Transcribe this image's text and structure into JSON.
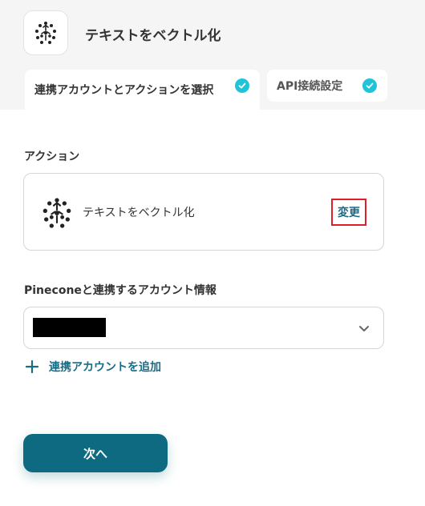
{
  "header": {
    "title": "テキストをベクトル化",
    "app_icon": "pinecone-logo-icon"
  },
  "tabs": [
    {
      "label": "連携アカウントとアクションを選択",
      "completed": true
    },
    {
      "label": "API接続設定",
      "completed": true
    }
  ],
  "action_section": {
    "label": "アクション",
    "action_name": "テキストをベクトル化",
    "action_icon": "pinecone-logo-icon",
    "change_label": "変更"
  },
  "account_section": {
    "label": "Pineconeと連携するアカウント情報",
    "selected_value_redacted": true,
    "add_account_label": "連携アカウントを追加"
  },
  "footer": {
    "next_label": "次へ"
  },
  "colors": {
    "accent": "#0e6a80",
    "check": "#1fc4d9",
    "link": "#1a6b86",
    "highlight_border": "#e01e2a"
  }
}
